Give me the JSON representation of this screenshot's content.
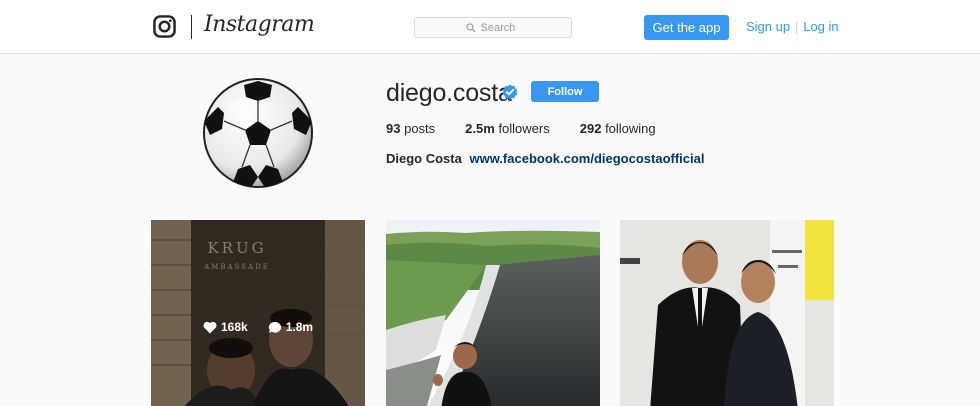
{
  "nav": {
    "wordmark": "Instagram",
    "search_placeholder": "Search",
    "get_app_label": "Get the app",
    "signup_label": "Sign up",
    "separator": "|",
    "login_label": "Log in"
  },
  "profile": {
    "username": "diego.costa",
    "verified": true,
    "follow_label": "Follow",
    "posts_count": "93",
    "posts_label": "posts",
    "followers_count": "2.5m",
    "followers_label": "followers",
    "following_count": "292",
    "following_label": "following",
    "full_name": "Diego Costa",
    "website": "www.facebook.com/diegocostaofficial",
    "avatar_icon": "soccer-ball-icon"
  },
  "posts": [
    {
      "likes": "168k",
      "comments": "1.8m",
      "hovered": true,
      "sign_text": "KRUG",
      "sign_subtext": "AMBASSADE"
    },
    {
      "hovered": false
    },
    {
      "hovered": false
    }
  ],
  "colors": {
    "accent": "#3897f0",
    "link": "#003569",
    "border": "#dbdbdb",
    "background": "#fafafa"
  }
}
